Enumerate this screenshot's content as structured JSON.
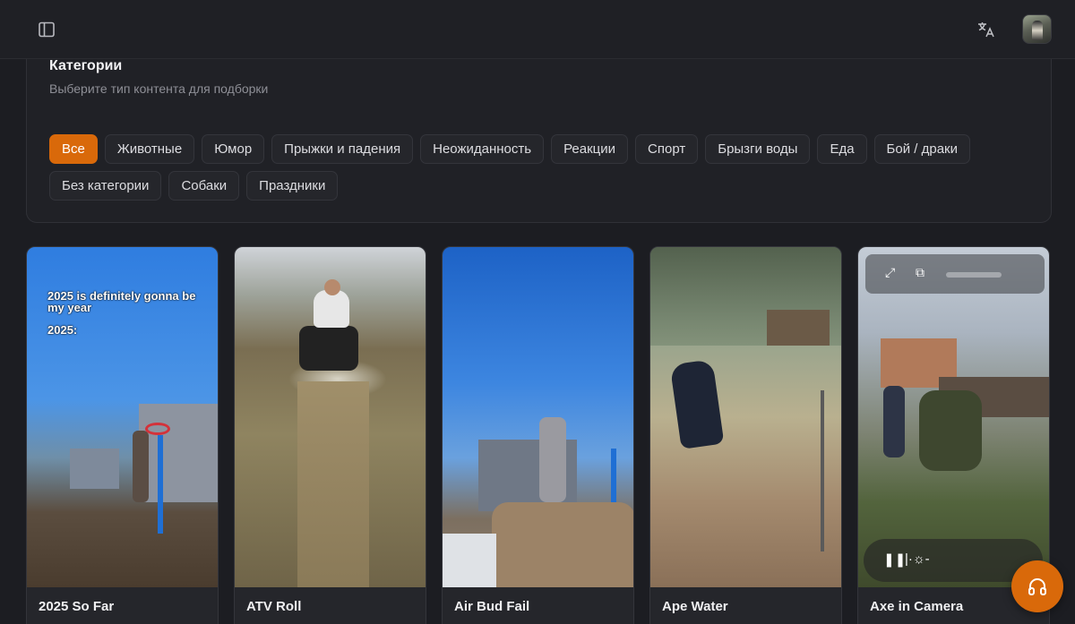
{
  "header": {
    "sidebar_icon": "sidebar-toggle-icon",
    "translate_icon": "translate-icon",
    "avatar_icon": "user-avatar"
  },
  "categories": {
    "title": "Категории",
    "subtitle": "Выберите тип контента для подборки",
    "active_color": "#d9690a",
    "chips": [
      {
        "label": "Все",
        "active": true
      },
      {
        "label": "Животные",
        "active": false
      },
      {
        "label": "Юмор",
        "active": false
      },
      {
        "label": "Прыжки и падения",
        "active": false
      },
      {
        "label": "Неожиданность",
        "active": false
      },
      {
        "label": "Реакции",
        "active": false
      },
      {
        "label": "Спорт",
        "active": false
      },
      {
        "label": "Брызги воды",
        "active": false
      },
      {
        "label": "Еда",
        "active": false
      },
      {
        "label": "Бой / драки",
        "active": false
      },
      {
        "label": "Без категории",
        "active": false
      },
      {
        "label": "Собаки",
        "active": false
      },
      {
        "label": "Праздники",
        "active": false
      }
    ]
  },
  "videos": [
    {
      "title": "2025 So Far",
      "overlay_line1": "2025 is definitely gonna be",
      "overlay_line2": "my year",
      "overlay_line3": "2025:"
    },
    {
      "title": "ATV Roll"
    },
    {
      "title": "Air Bud Fail"
    },
    {
      "title": "Ape Water"
    },
    {
      "title": "Axe in Camera"
    }
  ],
  "player": {
    "icons": [
      "fullscreen-icon",
      "picture-in-picture-icon",
      "pause-icon",
      "loading-icon"
    ]
  },
  "fab_icon": "headphones-icon"
}
